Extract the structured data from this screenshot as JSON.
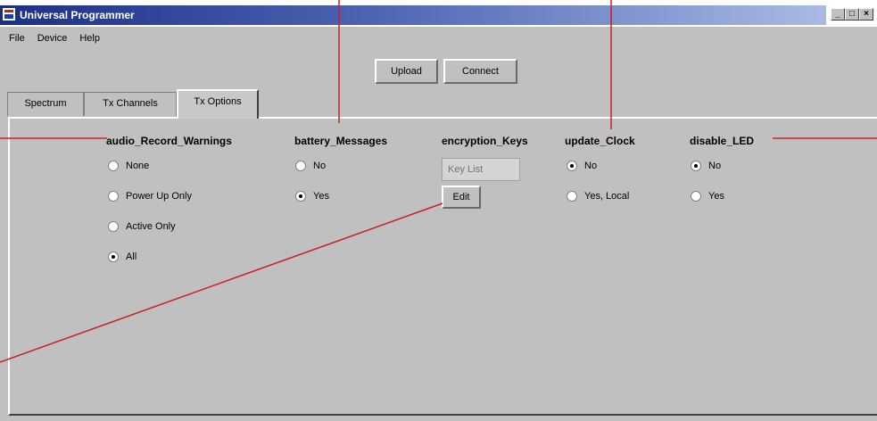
{
  "window": {
    "title": "Universal Programmer",
    "controls": [
      "_",
      "□",
      "×"
    ]
  },
  "menu": [
    "File",
    "Device",
    "Help"
  ],
  "toolbar": {
    "upload": "Upload",
    "connect": "Connect"
  },
  "tabs": [
    {
      "label": "Spectrum",
      "active": false
    },
    {
      "label": "Tx Channels",
      "active": false
    },
    {
      "label": "Tx Options",
      "active": true
    }
  ],
  "options": {
    "audio_record_warnings": {
      "heading": "audio_Record_Warnings",
      "choices": [
        {
          "label": "None",
          "selected": false
        },
        {
          "label": "Power Up Only",
          "selected": false
        },
        {
          "label": "Active Only",
          "selected": false
        },
        {
          "label": "All",
          "selected": true
        }
      ]
    },
    "battery_messages": {
      "heading": "battery_Messages",
      "choices": [
        {
          "label": "No",
          "selected": false
        },
        {
          "label": "Yes",
          "selected": true
        }
      ]
    },
    "encryption_keys": {
      "heading": "encryption_Keys",
      "field_placeholder": "Key List",
      "edit_label": "Edit"
    },
    "update_clock": {
      "heading": "update_Clock",
      "choices": [
        {
          "label": "No",
          "selected": true
        },
        {
          "label": "Yes, Local",
          "selected": false
        }
      ]
    },
    "disable_led": {
      "heading": "disable_LED",
      "choices": [
        {
          "label": "No",
          "selected": true
        },
        {
          "label": "Yes",
          "selected": false
        }
      ]
    }
  },
  "colors": {
    "callout": "#cc2020",
    "window_bg": "#c0c0c0",
    "titlebar": "#1c2f86"
  }
}
